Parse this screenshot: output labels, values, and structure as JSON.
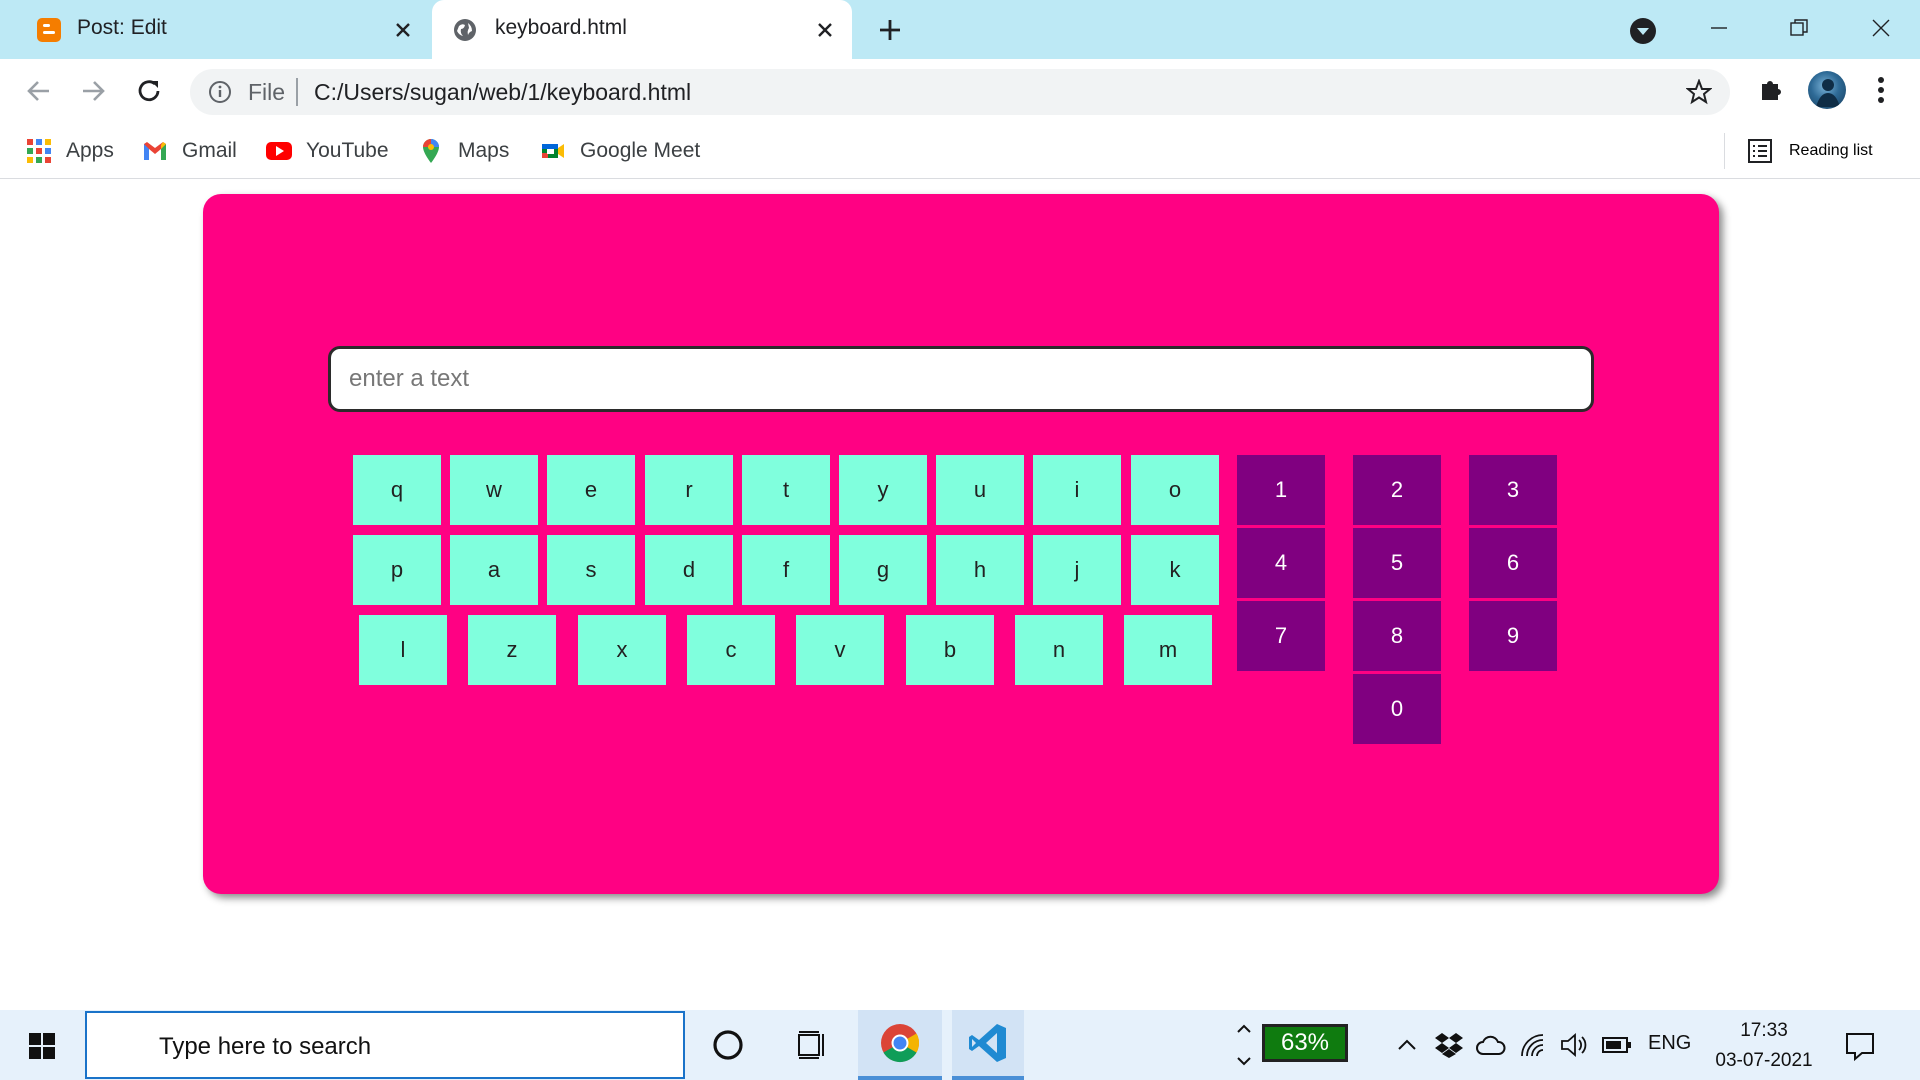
{
  "tabs": [
    {
      "title": "Post: Edit",
      "favicon": "blogger-icon",
      "active": false
    },
    {
      "title": "keyboard.html",
      "favicon": "globe-icon",
      "active": true
    }
  ],
  "omnibox": {
    "scheme": "File",
    "url": "C:/Users/sugan/web/1/keyboard.html"
  },
  "bookmarks": [
    {
      "label": "Apps",
      "icon": "apps-grid-icon"
    },
    {
      "label": "Gmail",
      "icon": "gmail-icon"
    },
    {
      "label": "YouTube",
      "icon": "youtube-icon"
    },
    {
      "label": "Maps",
      "icon": "maps-icon"
    },
    {
      "label": "Google Meet",
      "icon": "meet-icon"
    }
  ],
  "reading_list": "Reading list",
  "page": {
    "input_placeholder": "enter a text",
    "letter_rows": [
      [
        "q",
        "w",
        "e",
        "r",
        "t",
        "y",
        "u",
        "i",
        "o"
      ],
      [
        "p",
        "a",
        "s",
        "d",
        "f",
        "g",
        "h",
        "j",
        "k"
      ],
      [
        "l",
        "z",
        "x",
        "c",
        "v",
        "b",
        "n",
        "m"
      ]
    ],
    "number_rows": [
      [
        "1",
        "2",
        "3"
      ],
      [
        "4",
        "5",
        "6"
      ],
      [
        "7",
        "8",
        "9"
      ],
      [
        "0"
      ]
    ],
    "colors": {
      "card": "#ff0183",
      "letter_key": "#80ffdd",
      "number_key": "#800080"
    }
  },
  "taskbar": {
    "search_placeholder": "Type here to search",
    "battery_percent": "63%",
    "language": "ENG",
    "time": "17:33",
    "date": "03-07-2021"
  }
}
